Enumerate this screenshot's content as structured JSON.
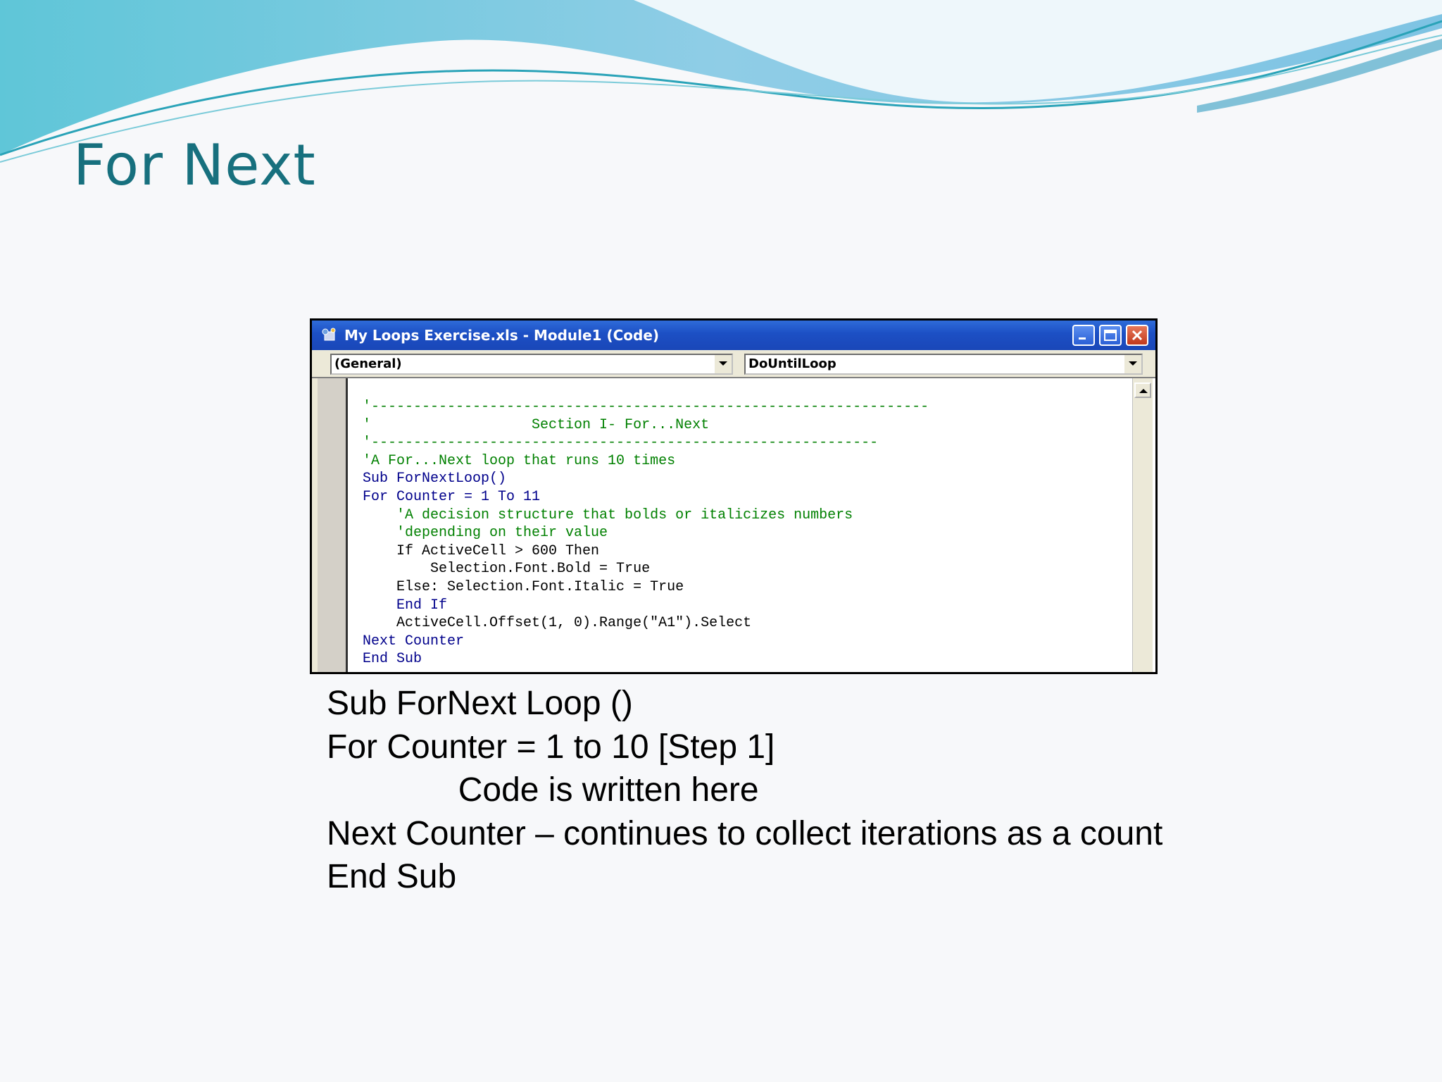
{
  "slide": {
    "title": "For Next",
    "theme_colors": {
      "title": "#17707e",
      "wave_dark": "#3ab0c8",
      "wave_light": "#a9d8ea"
    }
  },
  "window": {
    "title": "My Loops Exercise.xls - Module1 (Code)",
    "app_icon": "vba-module-icon",
    "buttons": [
      "minimize-icon",
      "maximize-icon",
      "close-icon"
    ],
    "object_combo": "(General)",
    "procedure_combo": "DoUntilLoop"
  },
  "code": {
    "lines": [
      "'------------------------------------------------------------------",
      "'                   Section I- For...Next",
      "'------------------------------------------------------------",
      "'A For...Next loop that runs 10 times",
      "Sub ForNextLoop()",
      "For Counter = 1 To 11",
      "    'A decision structure that bolds or italicizes numbers",
      "    'depending on their value",
      "    If ActiveCell > 600 Then",
      "        Selection.Font.Bold = True",
      "    Else: Selection.Font.Italic = True",
      "    End If",
      "    ActiveCell.Offset(1, 0).Range(\"A1\").Select",
      "Next Counter",
      "End Sub"
    ]
  },
  "notes": {
    "line1": "Sub ForNext Loop ()",
    "line2": "For Counter = 1 to 10 [Step 1]",
    "line3": "              Code is written here",
    "line4": "Next Counter – continues to collect iterations as a count",
    "line5": "End Sub"
  }
}
